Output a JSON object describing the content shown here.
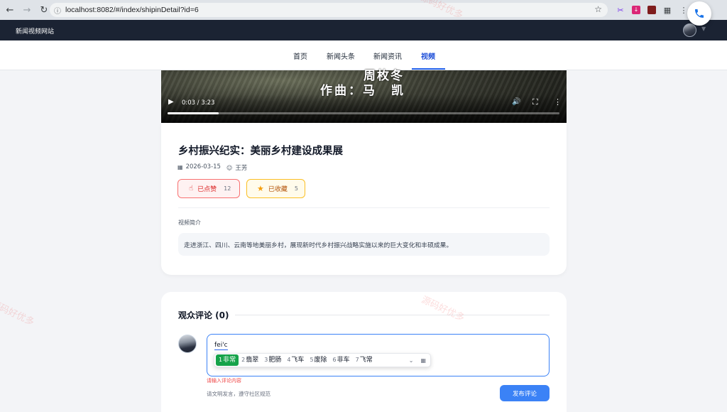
{
  "browser": {
    "url": "localhost:8082/#/index/shipinDetail?id=6"
  },
  "header": {
    "site_name": "新闻视频网站"
  },
  "nav": {
    "items": [
      {
        "label": "首页"
      },
      {
        "label": "新闻头条"
      },
      {
        "label": "新闻资讯"
      },
      {
        "label": "视频"
      }
    ],
    "active": "视频"
  },
  "video": {
    "subtitle_top": "周枚冬",
    "subtitle_bottom": "作曲：马　凯",
    "time": "0:03 / 3:23",
    "progress": 0.13
  },
  "article": {
    "title": "乡村振兴纪实：美丽乡村建设成果展",
    "date": "2026-03-15",
    "author": "王芳",
    "like_label": "已点赞",
    "like_count": "12",
    "fav_label": "已收藏",
    "fav_count": "5",
    "intro_label": "视频简介",
    "intro_text": "走进浙江、四川、云南等地美丽乡村，展现新时代乡村振兴战略实施以来的巨大变化和丰硕成果。"
  },
  "comments": {
    "title": "观众评论 (0)",
    "typed_text": "fei'c",
    "error": "请输入评论内容",
    "hint": "请文明发言，遵守社区规范",
    "submit_label": "发布评论"
  },
  "ime": {
    "candidates": [
      {
        "n": "1",
        "text": "非常"
      },
      {
        "n": "2",
        "text": "翡翠"
      },
      {
        "n": "3",
        "text": "肥肠"
      },
      {
        "n": "4",
        "text": "飞车"
      },
      {
        "n": "5",
        "text": "废除"
      },
      {
        "n": "6",
        "text": "非车"
      },
      {
        "n": "7",
        "text": "飞常"
      }
    ]
  },
  "watermark": "源码好优多",
  "colors": {
    "primary": "#3b82f6",
    "nav_active": "#1d4ed8",
    "like": "#dc2626",
    "favorite": "#f59e0b",
    "header_bg": "#1b2333",
    "ime_selected": "#16a34a"
  }
}
